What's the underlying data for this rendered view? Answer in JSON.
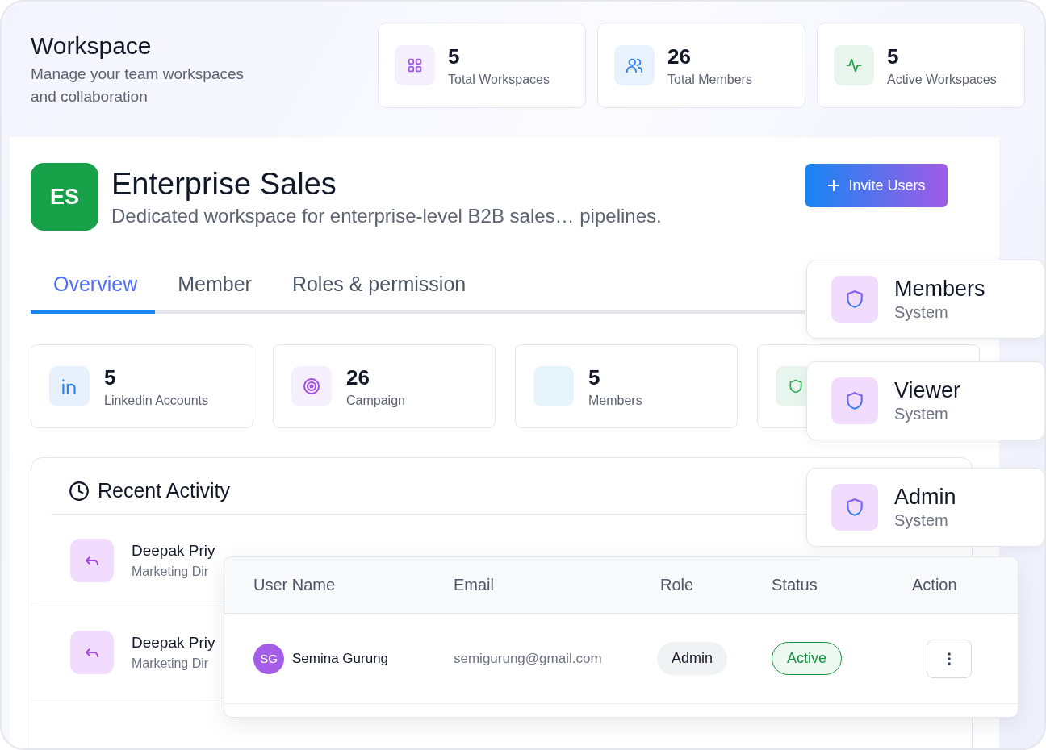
{
  "header": {
    "title": "Workspace",
    "subtitle": "Manage your team workspaces and collaboration"
  },
  "summary": [
    {
      "value": "5",
      "label": "Total Workspaces",
      "kind": "grid"
    },
    {
      "value": "26",
      "label": "Total Members",
      "kind": "users"
    },
    {
      "value": "5",
      "label": "Active Workspaces",
      "kind": "pulse"
    }
  ],
  "workspace": {
    "initials": "ES",
    "name": "Enterprise Sales",
    "description": "Dedicated workspace for enterprise-level B2B sales… pipelines.",
    "invite_button": "Invite Users"
  },
  "tabs": [
    {
      "label": "Overview",
      "selected": true
    },
    {
      "label": "Member",
      "selected": false
    },
    {
      "label": "Roles & permission",
      "selected": false
    }
  ],
  "stats": [
    {
      "value": "5",
      "label": "Linkedin Accounts",
      "kind": "linkedin"
    },
    {
      "value": "26",
      "label": "Campaign",
      "kind": "target"
    },
    {
      "value": "5",
      "label": "Members",
      "kind": "blank"
    },
    {
      "kind": "shield"
    }
  ],
  "activity": {
    "title": "Recent Activity",
    "items": [
      {
        "name": "Deepak Priy",
        "role": "Marketing Dir"
      },
      {
        "name": "Deepak Priy",
        "role": "Marketing Dir"
      }
    ]
  },
  "roles": [
    {
      "name": "Members",
      "type": "System"
    },
    {
      "name": "Viewer",
      "type": "System"
    },
    {
      "name": "Admin",
      "type": "System"
    }
  ],
  "users_table": {
    "columns": [
      "User Name",
      "Email",
      "Role",
      "Status",
      "Action"
    ],
    "rows": [
      {
        "initials": "SG",
        "name": "Semina Gurung",
        "email": "semigurung@gmail.com",
        "role": "Admin",
        "status": "Active",
        "active": true
      }
    ]
  }
}
